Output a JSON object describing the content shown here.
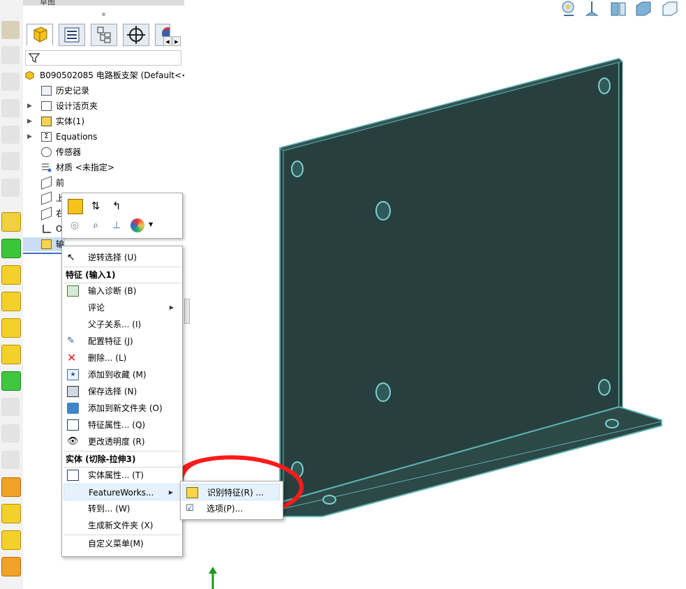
{
  "top_tabs": {
    "features_label": "特征",
    "sketch_label": "草图"
  },
  "tree": {
    "root_label": "B090502085 电路板支架 (Default<<",
    "items": [
      {
        "label": "历史记录",
        "icon": "history-icon",
        "expandable": false
      },
      {
        "label": "设计活页夹",
        "icon": "design-binder-icon",
        "expandable": true
      },
      {
        "label": "实体(1)",
        "icon": "solid-bodies-icon",
        "expandable": true
      },
      {
        "label": "Equations",
        "icon": "equations-icon",
        "expandable": true
      },
      {
        "label": "传感器",
        "icon": "sensors-icon",
        "expandable": false
      },
      {
        "label": "材质 <未指定>",
        "icon": "material-icon",
        "expandable": false
      },
      {
        "label": "前",
        "icon": "plane-icon",
        "expandable": false
      },
      {
        "label": "上",
        "icon": "plane-icon",
        "expandable": false
      },
      {
        "label": "右",
        "icon": "plane-icon",
        "expandable": false
      },
      {
        "label": "O",
        "icon": "origin-icon",
        "expandable": false
      },
      {
        "label": "输入1",
        "icon": "imported-feature-icon",
        "expandable": false
      }
    ]
  },
  "context_menu": {
    "invert_selection": "逆转选择 (U)",
    "header_feature": "特征 (输入1)",
    "import_diagnostics": "输入诊断 (B)",
    "comment": "评论",
    "parent_child": "父子关系... (I)",
    "configure_feature": "配置特征 (J)",
    "delete": "删除... (L)",
    "add_to_favorites": "添加到收藏 (M)",
    "save_selection": "保存选择 (N)",
    "add_to_new_folder": "添加到新文件夹 (O)",
    "feature_properties": "特征属性... (Q)",
    "change_transparency": "更改透明度 (R)",
    "header_body": "实体 (切除-拉伸3)",
    "body_properties": "实体属性... (T)",
    "featureworks": "FeatureWorks...",
    "go_to": "转到... (W)",
    "create_new_folder": "生成新文件夹 (X)",
    "customize_menu": "自定义菜单(M)"
  },
  "submenu": {
    "recognize_features": "识别特征(R) ...",
    "options": "选项(P)..."
  },
  "colors": {
    "part_face": "#27403f",
    "part_edge": "#5fb3b3",
    "annotation_circle": "#ff1a1a"
  }
}
